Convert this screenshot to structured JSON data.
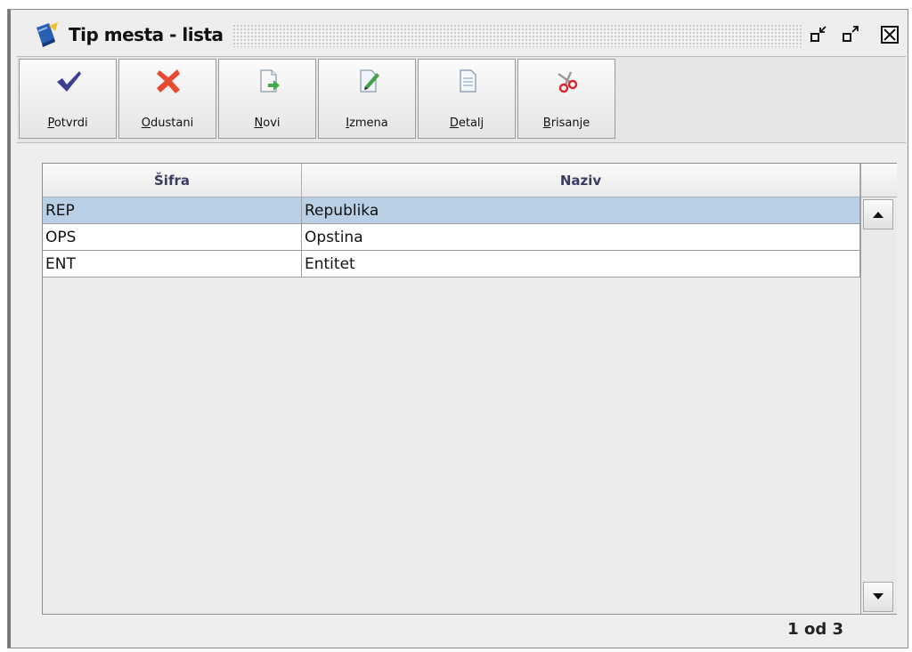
{
  "window": {
    "title": "Tip mesta - lista"
  },
  "toolbar": {
    "buttons": [
      {
        "label": "Potvrdi",
        "icon": "checkmark-icon"
      },
      {
        "label": "Odustani",
        "icon": "cancel-x-icon"
      },
      {
        "label": "Novi",
        "icon": "new-document-icon"
      },
      {
        "label": "Izmena",
        "icon": "edit-document-icon"
      },
      {
        "label": "Detalj",
        "icon": "document-detail-icon"
      },
      {
        "label": "Brisanje",
        "icon": "scissors-icon"
      }
    ]
  },
  "table": {
    "columns": [
      "Šifra",
      "Naziv"
    ],
    "rows": [
      {
        "sifra": "REP",
        "naziv": "Republika",
        "selected": true
      },
      {
        "sifra": "OPS",
        "naziv": "Opstina",
        "selected": false
      },
      {
        "sifra": "ENT",
        "naziv": "Entitet",
        "selected": false
      }
    ]
  },
  "status": {
    "pagination": "1 od 3"
  },
  "colors": {
    "selection": "#b8cfe5",
    "header_text": "#3c3c62",
    "check": "#3b3f8f",
    "cancel": "#e8492f"
  }
}
